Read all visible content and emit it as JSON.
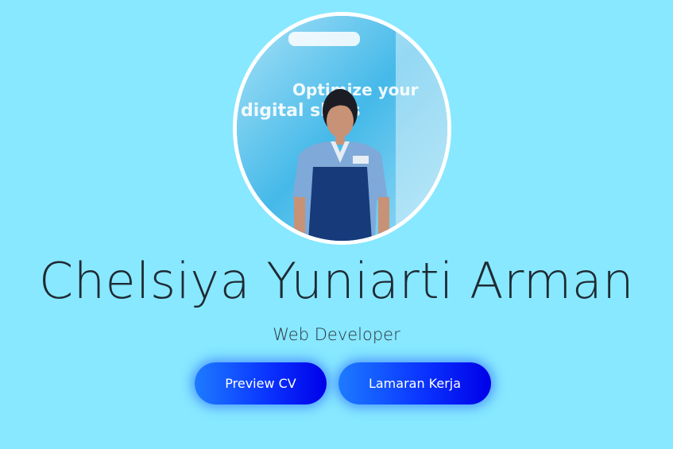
{
  "profile": {
    "name": "Chelsiya Yuniarti Arman",
    "role": "Web Developer",
    "photo_backdrop_text_line1": "Optimize your",
    "photo_backdrop_text_line2": "digital skills"
  },
  "actions": {
    "preview_cv_label": "Preview CV",
    "lamaran_kerja_label": "Lamaran Kerja"
  },
  "colors": {
    "page_background": "#87e8ff",
    "button_gradient_start": "#1d7bff",
    "button_gradient_end": "#0000e8",
    "text_dark": "#1f2a33"
  }
}
